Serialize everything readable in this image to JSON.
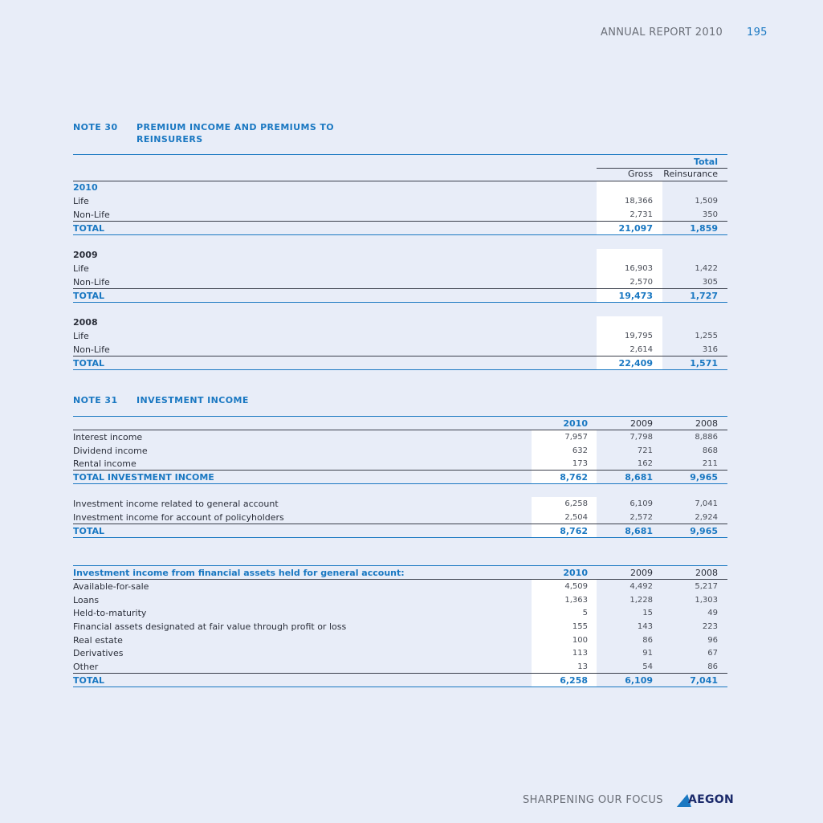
{
  "header": {
    "title": "ANNUAL REPORT 2010",
    "page": "195"
  },
  "note30": {
    "number": "NOTE 30",
    "title_line1": "PREMIUM INCOME AND PREMIUMS TO",
    "title_line2": "REINSURERS",
    "col_group": "Total",
    "cols": [
      "Gross",
      "Reinsurance"
    ],
    "sections": [
      {
        "year": "2010",
        "rows": [
          {
            "label": "Life",
            "values": [
              "18,366",
              "1,509"
            ]
          },
          {
            "label": "Non-Life",
            "values": [
              "2,731",
              "350"
            ]
          }
        ],
        "total": {
          "label": "TOTAL",
          "values": [
            "21,097",
            "1,859"
          ]
        }
      },
      {
        "year": "2009",
        "rows": [
          {
            "label": "Life",
            "values": [
              "16,903",
              "1,422"
            ]
          },
          {
            "label": "Non-Life",
            "values": [
              "2,570",
              "305"
            ]
          }
        ],
        "total": {
          "label": "TOTAL",
          "values": [
            "19,473",
            "1,727"
          ]
        }
      },
      {
        "year": "2008",
        "rows": [
          {
            "label": "Life",
            "values": [
              "19,795",
              "1,255"
            ]
          },
          {
            "label": "Non-Life",
            "values": [
              "2,614",
              "316"
            ]
          }
        ],
        "total": {
          "label": "TOTAL",
          "values": [
            "22,409",
            "1,571"
          ]
        }
      }
    ]
  },
  "note31": {
    "number": "NOTE 31",
    "title": "INVESTMENT INCOME",
    "cols": [
      "2010",
      "2009",
      "2008"
    ],
    "table1": {
      "rows": [
        {
          "label": "Interest income",
          "values": [
            "7,957",
            "7,798",
            "8,886"
          ]
        },
        {
          "label": "Dividend income",
          "values": [
            "632",
            "721",
            "868"
          ]
        },
        {
          "label": "Rental income",
          "values": [
            "173",
            "162",
            "211"
          ]
        }
      ],
      "total": {
        "label": "TOTAL INVESTMENT INCOME",
        "values": [
          "8,762",
          "8,681",
          "9,965"
        ]
      },
      "rows2": [
        {
          "label": "Investment income related to general account",
          "values": [
            "6,258",
            "6,109",
            "7,041"
          ]
        },
        {
          "label": "Investment income for account of policyholders",
          "values": [
            "2,504",
            "2,572",
            "2,924"
          ]
        }
      ],
      "total2": {
        "label": "TOTAL",
        "values": [
          "8,762",
          "8,681",
          "9,965"
        ]
      }
    },
    "table2": {
      "heading": "Investment income from financial assets held for general account:",
      "rows": [
        {
          "label": "Available-for-sale",
          "values": [
            "4,509",
            "4,492",
            "5,217"
          ]
        },
        {
          "label": "Loans",
          "values": [
            "1,363",
            "1,228",
            "1,303"
          ]
        },
        {
          "label": "Held-to-maturity",
          "values": [
            "5",
            "15",
            "49"
          ]
        },
        {
          "label": "Financial assets designated at fair value through profit or loss",
          "values": [
            "155",
            "143",
            "223"
          ]
        },
        {
          "label": "Real estate",
          "values": [
            "100",
            "86",
            "96"
          ]
        },
        {
          "label": "Derivatives",
          "values": [
            "113",
            "91",
            "67"
          ]
        },
        {
          "label": "Other",
          "values": [
            "13",
            "54",
            "86"
          ]
        }
      ],
      "total": {
        "label": "TOTAL",
        "values": [
          "6,258",
          "6,109",
          "7,041"
        ]
      }
    }
  },
  "footer": {
    "tagline": "SHARPENING OUR FOCUS",
    "logo_text": "AEGON"
  },
  "colors": {
    "accent": "#1a78c2",
    "background": "#e8edf8",
    "text": "#2b2f3a"
  }
}
